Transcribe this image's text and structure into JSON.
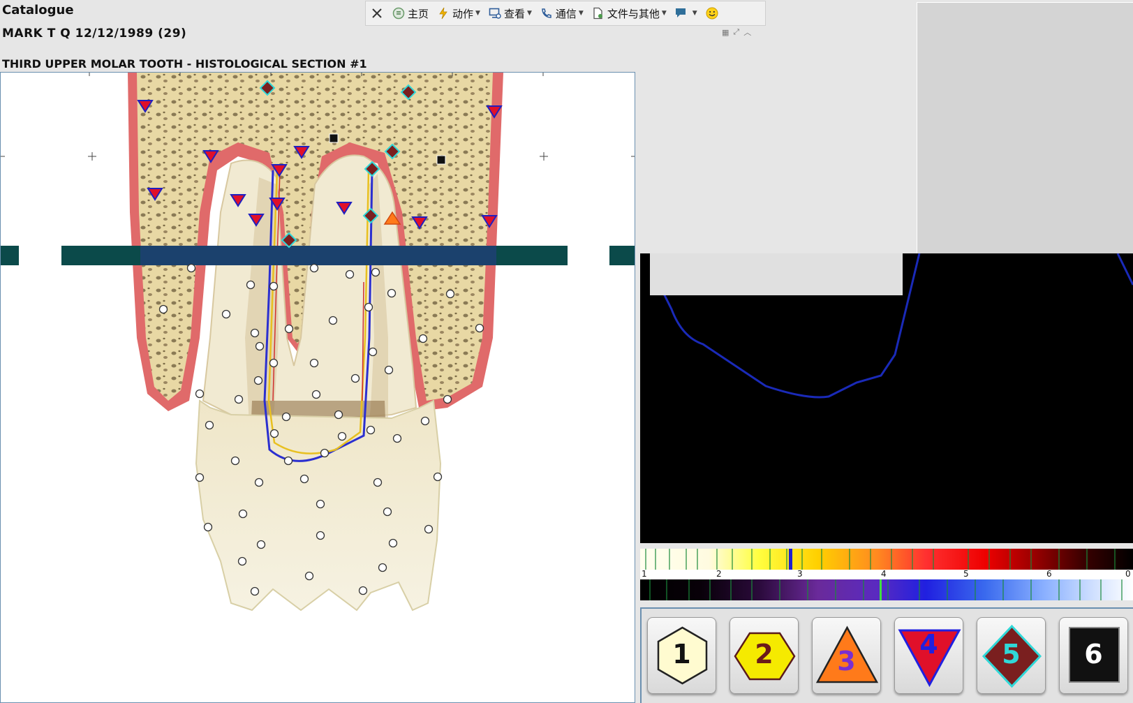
{
  "header": {
    "app_title": "Catalogue",
    "patient": "MARK T Q 12/12/1989 (29)",
    "section_title": "THIRD UPPER MOLAR TOOTH - HISTOLOGICAL SECTION #1"
  },
  "toolbar": {
    "items": [
      {
        "label": "主页",
        "icon": "home-icon"
      },
      {
        "label": "动作",
        "icon": "lightning-icon"
      },
      {
        "label": "查看",
        "icon": "view-icon"
      },
      {
        "label": "通信",
        "icon": "phone-icon"
      },
      {
        "label": "文件与其他",
        "icon": "file-icon"
      }
    ],
    "close_icon": "close-icon",
    "chat_icon": "chat-icon",
    "smile_icon": "smiley-icon"
  },
  "spectrum_scale": {
    "labels": [
      "1",
      "2",
      "3",
      "4",
      "5",
      "6",
      "0"
    ]
  },
  "marker_buttons": [
    {
      "label": "1",
      "shape": "hexagon",
      "fill": "#fffbd0",
      "text_color": "#111"
    },
    {
      "label": "2",
      "shape": "hexagon",
      "fill": "#f5ea00",
      "text_color": "#6b1a1a"
    },
    {
      "label": "3",
      "shape": "triangle-up",
      "fill": "#ff7a1a",
      "text_color": "#7a2fd0"
    },
    {
      "label": "4",
      "shape": "triangle-down",
      "fill": "#e0102a",
      "text_color": "#2020e0"
    },
    {
      "label": "5",
      "shape": "diamond",
      "fill": "#7a1f1f",
      "text_color": "#30d8d8"
    },
    {
      "label": "6",
      "shape": "square",
      "fill": "#111111",
      "text_color": "#ffffff"
    }
  ],
  "colors": {
    "frame_border": "#6a8faf",
    "graph_line": "#1a2ab8",
    "graph_bg": "#000000"
  }
}
